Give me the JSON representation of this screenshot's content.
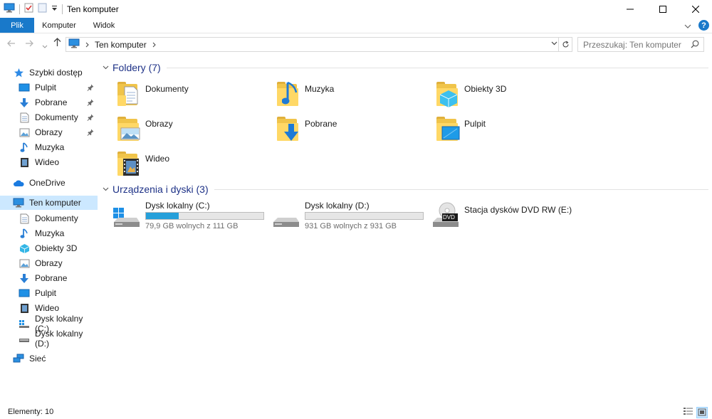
{
  "window": {
    "title": "Ten komputer",
    "controls": [
      "minimize",
      "maximize",
      "close"
    ]
  },
  "ribbon": {
    "tabs": [
      {
        "label": "Plik"
      },
      {
        "label": "Komputer"
      },
      {
        "label": "Widok"
      }
    ],
    "help_label": "?"
  },
  "address": {
    "path": [
      "Ten komputer"
    ],
    "search_placeholder": "Przeszukaj: Ten komputer"
  },
  "nav": {
    "quick_access": "Szybki dostęp",
    "quick_items": [
      {
        "label": "Pulpit",
        "icon": "desktop-icon",
        "pinned": true
      },
      {
        "label": "Pobrane",
        "icon": "download-icon",
        "pinned": true
      },
      {
        "label": "Dokumenty",
        "icon": "document-icon",
        "pinned": true
      },
      {
        "label": "Obrazy",
        "icon": "pictures-icon",
        "pinned": true
      },
      {
        "label": "Muzyka",
        "icon": "music-icon",
        "pinned": false
      },
      {
        "label": "Wideo",
        "icon": "video-icon",
        "pinned": false
      }
    ],
    "onedrive": "OneDrive",
    "this_pc": "Ten komputer",
    "pc_items": [
      {
        "label": "Dokumenty",
        "icon": "document-icon"
      },
      {
        "label": "Muzyka",
        "icon": "music-icon"
      },
      {
        "label": "Obiekty 3D",
        "icon": "3d-objects-icon"
      },
      {
        "label": "Obrazy",
        "icon": "pictures-icon"
      },
      {
        "label": "Pobrane",
        "icon": "download-icon"
      },
      {
        "label": "Pulpit",
        "icon": "desktop-icon"
      },
      {
        "label": "Wideo",
        "icon": "video-icon"
      },
      {
        "label": "Dysk lokalny (C:)",
        "icon": "windows-drive-icon"
      },
      {
        "label": "Dysk lokalny (D:)",
        "icon": "drive-icon"
      }
    ],
    "network": "Sieć"
  },
  "content": {
    "folders_header": "Foldery (7)",
    "folders": [
      {
        "label": "Dokumenty",
        "icon": "document-folder-icon"
      },
      {
        "label": "Muzyka",
        "icon": "music-folder-icon"
      },
      {
        "label": "Obiekty 3D",
        "icon": "3d-objects-folder-icon"
      },
      {
        "label": "Obrazy",
        "icon": "pictures-folder-icon"
      },
      {
        "label": "Pobrane",
        "icon": "download-folder-icon"
      },
      {
        "label": "Pulpit",
        "icon": "desktop-folder-icon"
      },
      {
        "label": "Wideo",
        "icon": "video-folder-icon"
      }
    ],
    "drives_header": "Urządzenia i dyski (3)",
    "drives": [
      {
        "label": "Dysk lokalny (C:)",
        "free": "79,9 GB wolnych z 111 GB",
        "used_fraction": 0.28,
        "icon": "windows-drive-icon"
      },
      {
        "label": "Dysk lokalny (D:)",
        "free": "931 GB wolnych z 931 GB",
        "used_fraction": 0.0,
        "icon": "drive-icon"
      },
      {
        "label": "Stacja dysków DVD RW (E:)",
        "icon": "dvd-drive-icon",
        "dvd_text": "DVD"
      }
    ]
  },
  "status": {
    "items_count": "Elementy: 10"
  },
  "colors": {
    "accent": "#1979ca",
    "selection": "#cce8ff",
    "group_header": "#1e3287",
    "drive_fill": "#26a0da"
  }
}
